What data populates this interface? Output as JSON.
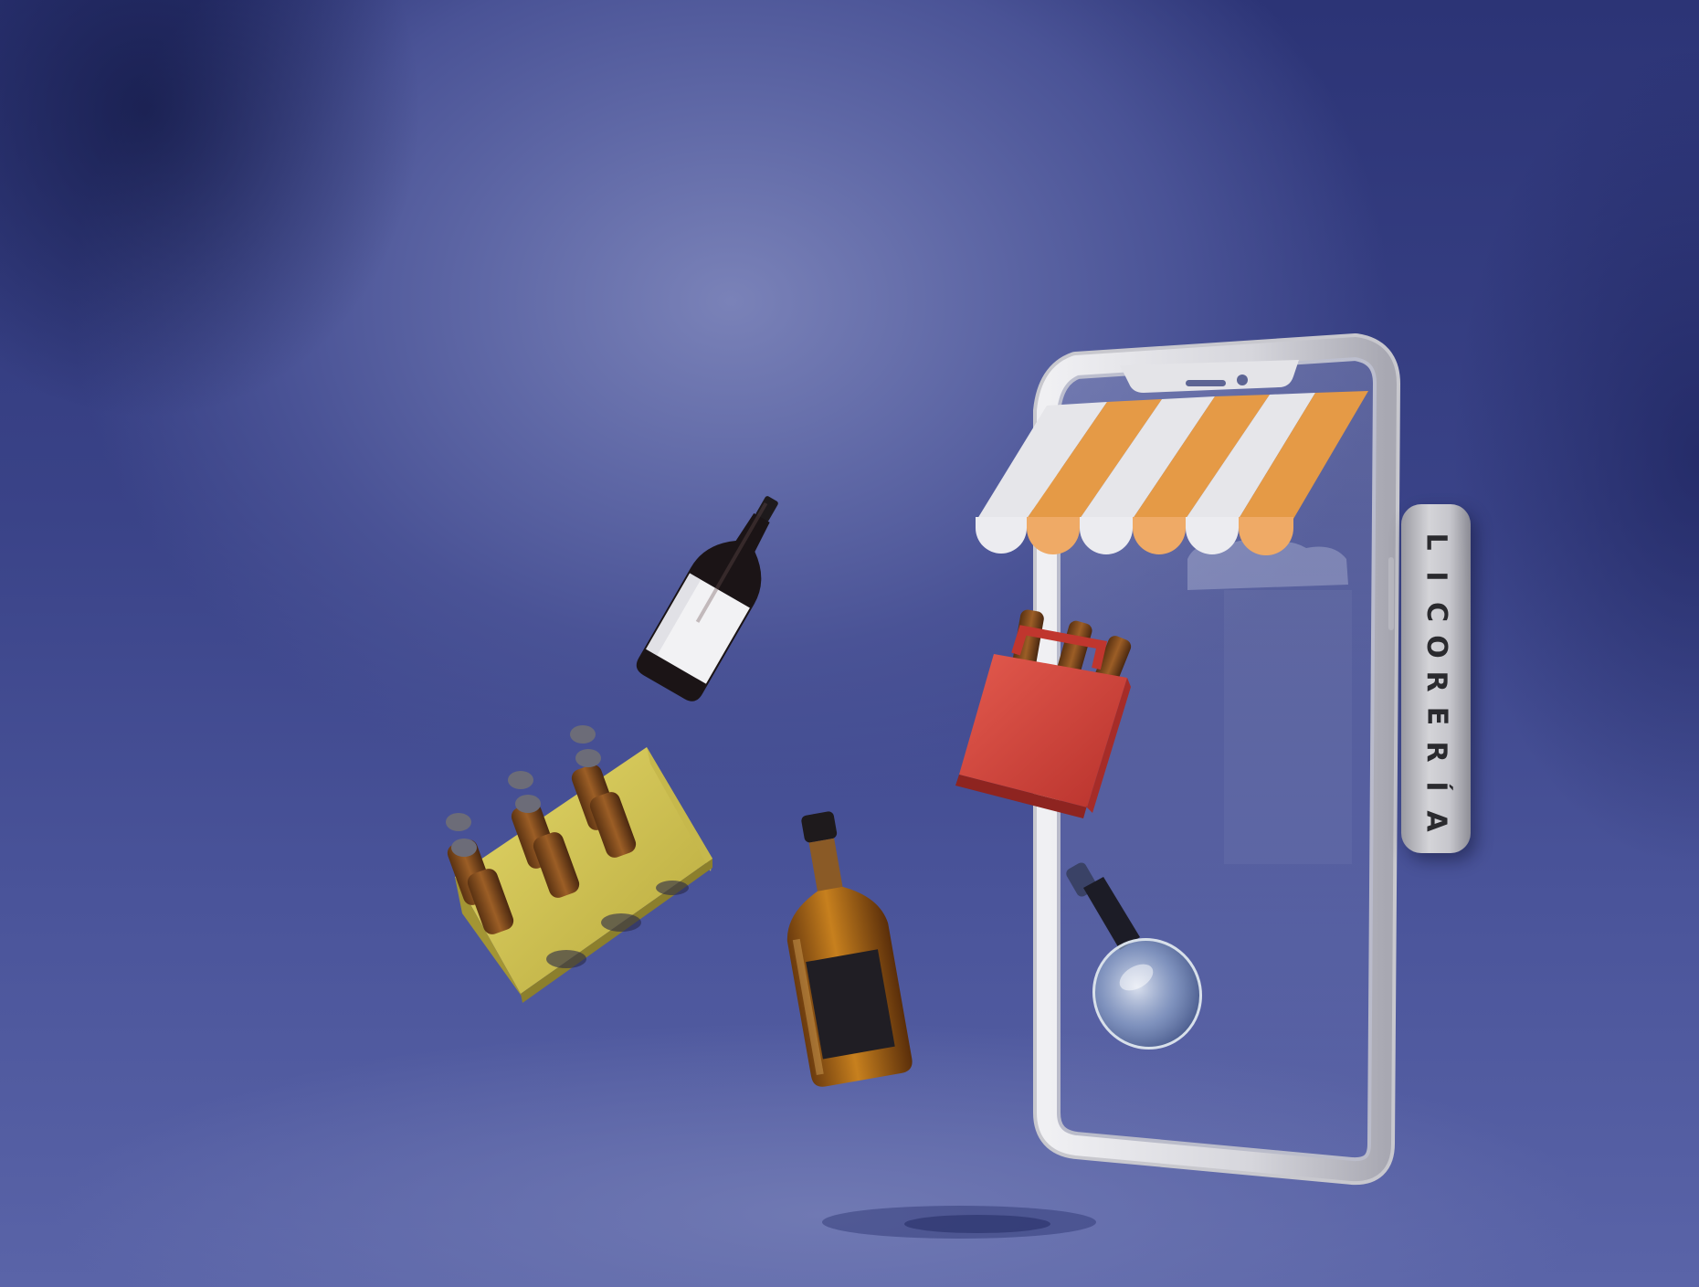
{
  "scene": {
    "background_color": "#4a5396",
    "accent_colors": {
      "awning_orange": "#e59a46",
      "awning_white": "#e6e6ea",
      "phone_frame": "#d8d8dc",
      "beer_crate_red": "#d94b40",
      "six_pack_yellow": "#d8cb58",
      "whisky_amber": "#b06a1c"
    }
  },
  "store_sign": {
    "text": "LICORERÍA",
    "letters": [
      "L",
      "I",
      "C",
      "O",
      "R",
      "E",
      "R",
      "Í",
      "A"
    ]
  },
  "objects": [
    {
      "name": "phone-storefront",
      "icon": "smartphone-icon"
    },
    {
      "name": "awning",
      "icon": "striped-awning-icon"
    },
    {
      "name": "wine-bottle",
      "icon": "wine-bottle-icon"
    },
    {
      "name": "yellow-six-pack",
      "icon": "beer-six-pack-icon"
    },
    {
      "name": "whisky-bottle",
      "icon": "whisky-bottle-icon"
    },
    {
      "name": "red-beer-crate",
      "icon": "beer-crate-icon"
    },
    {
      "name": "glass-decanter",
      "icon": "decanter-icon"
    }
  ]
}
